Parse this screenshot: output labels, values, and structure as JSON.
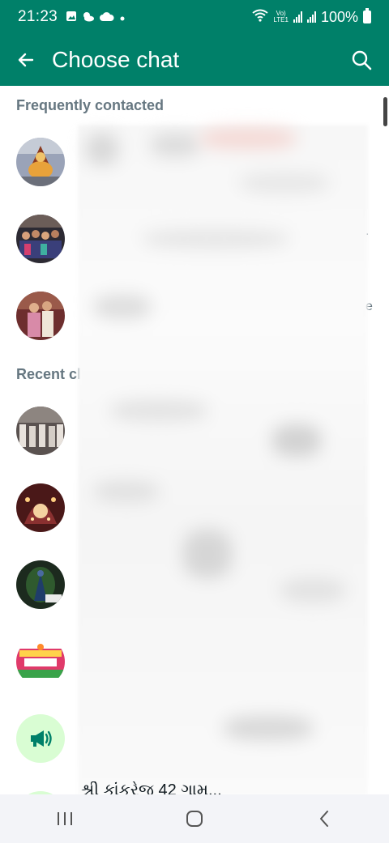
{
  "status_bar": {
    "time": "21:23",
    "battery_percent": "100%",
    "network_label_top": "Vo)",
    "network_label_bottom": "LTE1",
    "left_icons": [
      "gallery-icon",
      "weather-icon",
      "cloud-icon",
      "dot-icon"
    ],
    "right_icons": [
      "wifi-icon",
      "signal-icon",
      "signal-icon",
      "battery-icon"
    ]
  },
  "app_bar": {
    "title": "Choose chat",
    "back_icon": "arrow-left-icon",
    "search_icon": "search-icon",
    "color": "#008069"
  },
  "sections": {
    "frequent_label": "Frequently contacted",
    "recent_label": "Recent cl"
  },
  "edge_chars": {
    "row2": ".",
    "row3": "e"
  },
  "bottom_peek_text": "શ્રી કાંકરેજ 42 ગામ...",
  "nav_bar": {
    "recents_icon": "recents-icon",
    "home_icon": "home-icon",
    "back_icon": "nav-back-icon"
  },
  "colors": {
    "accent": "#008069",
    "announcement_bg": "#d9fdd3",
    "announcement_fg": "#008069"
  }
}
